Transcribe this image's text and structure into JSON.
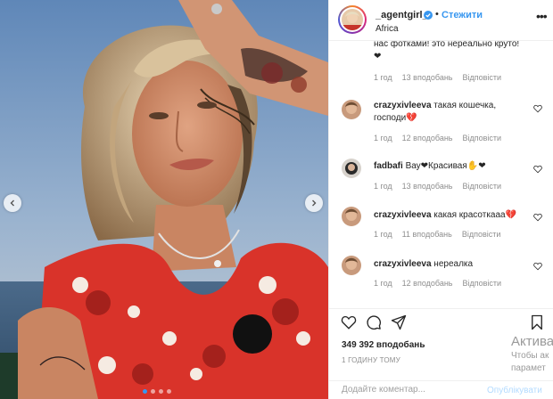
{
  "post": {
    "header": {
      "username": "_agentgirl_",
      "separator": "•",
      "follow_label": "Стежити",
      "location": "Africa",
      "more_icon": "ellipsis-icon",
      "verified_icon": "verified-badge-icon"
    },
    "photo": {
      "description_icon": "photo",
      "carousel_dots": 4,
      "active_dot": 0
    },
    "comments": [
      {
        "user": "",
        "text": "нас фотками! это нереально круто!❤",
        "time": "1 год",
        "likes": "13 вподобань",
        "reply": "Відповісти",
        "show_avatar": false
      },
      {
        "user": "crazyxivleeva",
        "text": "такая кошечка, господи💔",
        "time": "1 год",
        "likes": "12 вподобань",
        "reply": "Відповісти",
        "show_avatar": true
      },
      {
        "user": "fadbafi",
        "text": "Вау❤Красивая✋❤",
        "time": "1 год",
        "likes": "13 вподобань",
        "reply": "Відповісти",
        "show_avatar": true
      },
      {
        "user": "crazyxivleeva",
        "text": "какая красоткааа💔",
        "time": "1 год",
        "likes": "11 вподобань",
        "reply": "Відповісти",
        "show_avatar": true
      },
      {
        "user": "crazyxivleeva",
        "text": "нереалка",
        "time": "1 год",
        "likes": "12 вподобань",
        "reply": "Відповісти",
        "show_avatar": true
      }
    ],
    "actions": {
      "like_icon": "heart-icon",
      "comment_icon": "comment-icon",
      "share_icon": "share-icon",
      "save_icon": "bookmark-icon",
      "likes_count": "349 392 вподобань",
      "posted_time": "1 ГОДИНУ ТОМУ",
      "comment_placeholder": "Додайте коментар...",
      "publish_label": "Опублікувати"
    },
    "os_overlay": {
      "title": "Актива",
      "line1": "Чтобы ак",
      "line2": "парамет"
    },
    "colors": {
      "accent": "#3897f0",
      "muted": "#8e8e8e",
      "text": "#262626",
      "heart": "#ed4956"
    }
  }
}
